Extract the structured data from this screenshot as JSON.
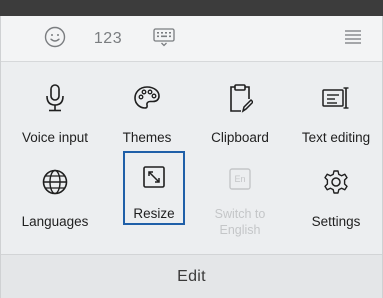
{
  "toolbar": {
    "emoji_icon": "smiley-face-icon",
    "numbers_label": "123",
    "keyboard_icon": "keyboard-down-icon",
    "menu_icon": "hamburger-menu-icon"
  },
  "grid": {
    "items": [
      {
        "label": "Voice input",
        "icon": "microphone-icon",
        "enabled": true,
        "selected": false
      },
      {
        "label": "Themes",
        "icon": "palette-icon",
        "enabled": true,
        "selected": false
      },
      {
        "label": "Clipboard",
        "icon": "clipboard-icon",
        "enabled": true,
        "selected": false
      },
      {
        "label": "Text editing",
        "icon": "text-cursor-icon",
        "enabled": true,
        "selected": false
      },
      {
        "label": "Languages",
        "icon": "globe-icon",
        "enabled": true,
        "selected": false
      },
      {
        "label": "Resize",
        "icon": "resize-icon",
        "enabled": true,
        "selected": true
      },
      {
        "label": "Switch to English",
        "label_line1": "Switch to",
        "label_line2": "English",
        "icon": "en-key-icon",
        "icon_text": "En",
        "enabled": false,
        "selected": false
      },
      {
        "label": "Settings",
        "icon": "gear-icon",
        "enabled": true,
        "selected": false
      }
    ]
  },
  "bottom": {
    "edit_label": "Edit"
  },
  "colors": {
    "selection_outline": "#1f5fa8",
    "disabled_text": "#c4c6c8",
    "background": "#eceef0"
  }
}
